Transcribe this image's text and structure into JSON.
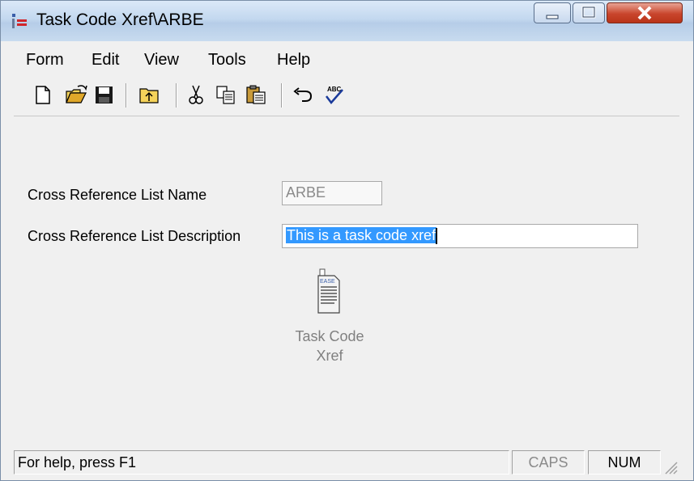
{
  "window": {
    "title": "Task Code Xref\\ARBE"
  },
  "menu": [
    "Form",
    "Edit",
    "View",
    "Tools",
    "Help"
  ],
  "toolbar": {
    "buttons": [
      "new-icon",
      "open-icon",
      "save-icon",
      "folder-up-icon",
      "cut-icon",
      "copy-icon",
      "paste-icon",
      "undo-icon",
      "spellcheck-icon"
    ]
  },
  "form": {
    "name_label": "Cross Reference List Name",
    "name_value": "ARBE",
    "desc_label": "Cross Reference List Description",
    "desc_value": "This is a task code xref"
  },
  "item": {
    "label_line1": "Task Code",
    "label_line2": "Xref"
  },
  "status": {
    "help": "For help, press F1",
    "caps": "CAPS",
    "num": "NUM"
  },
  "colors": {
    "selection": "#3399ff",
    "titlebar": "#c3d8ef",
    "close_button": "#c9452c"
  }
}
